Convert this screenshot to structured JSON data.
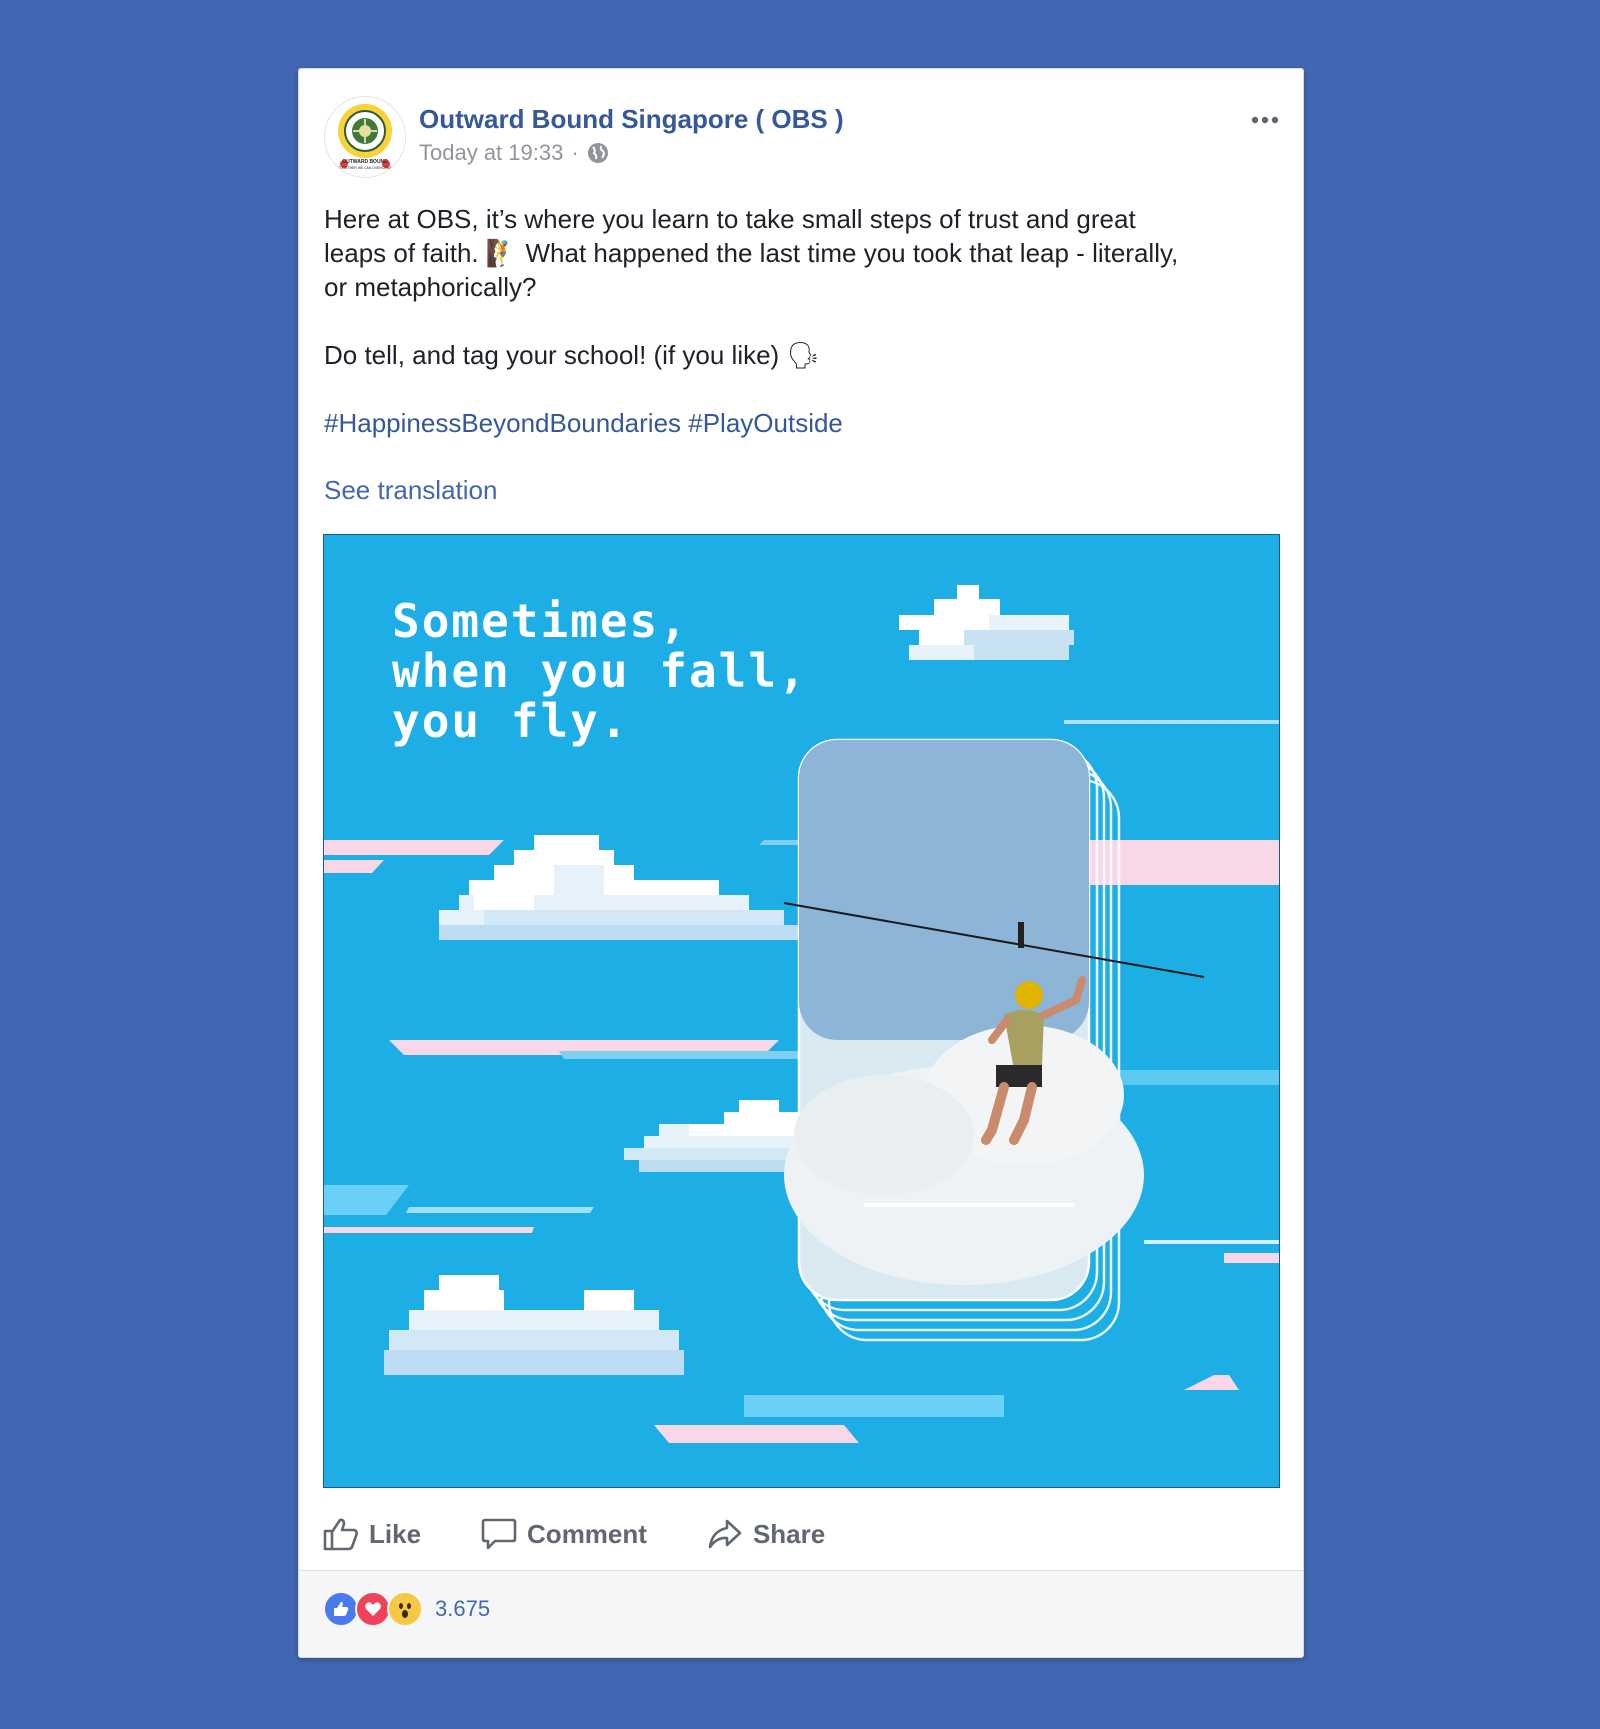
{
  "post": {
    "page_name": "Outward Bound Singapore ( OBS )",
    "timestamp": "Today at 19:33",
    "separator": "·",
    "privacy_icon": "globe-icon",
    "more_icon": "ellipsis-icon",
    "avatar": {
      "logo_text_top": "OUTWARD BOUND",
      "logo_text_bottom": "TOGETHER WE CAN OVERCOME"
    },
    "text_line1": "Here at OBS, it’s where you learn to take small steps of trust and great",
    "text_line2_a": "leaps of faith.",
    "text_line2_b": " What happened the last time you took that leap - literally,",
    "text_line3": "or metaphorically?",
    "text_line4": "Do tell, and tag your school! (if you like) ",
    "hashtags": "#HappinessBeyondBoundaries #PlayOutside",
    "see_translation": "See translation",
    "emoji_1": "🧗",
    "emoji_2": "🗣",
    "image": {
      "headline_line1": "Sometimes,",
      "headline_line2": "when you fall,",
      "headline_line3": "you fly."
    }
  },
  "actions": {
    "like": "Like",
    "comment": "Comment",
    "share": "Share"
  },
  "reactions": {
    "count": "3.675",
    "types": [
      "like-icon",
      "love-icon",
      "wow-icon"
    ]
  },
  "colors": {
    "background": "#4267b2",
    "sky": "#1eaee6",
    "link": "#365899",
    "like_blue": "#4a7af0",
    "love_red": "#f0425b",
    "wow_yellow": "#f7c844"
  }
}
